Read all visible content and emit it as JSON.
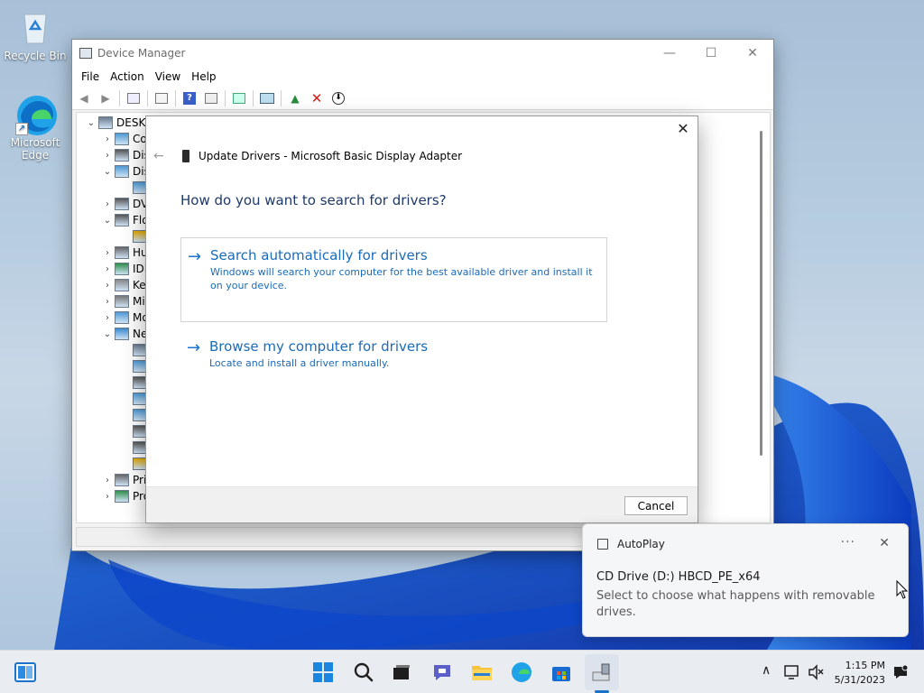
{
  "desktop": {
    "icons": [
      {
        "label": "Recycle Bin"
      },
      {
        "label": "Microsoft Edge"
      }
    ]
  },
  "device_manager": {
    "title": "Device Manager",
    "window_controls": {
      "minimize": "—",
      "maximize": "☐",
      "close": "✕"
    },
    "menu": [
      "File",
      "Action",
      "View",
      "Help"
    ],
    "tree": [
      {
        "chev": "⌄",
        "label": "DESKTO"
      },
      {
        "chev": "›",
        "label": "Co"
      },
      {
        "chev": "›",
        "label": "Dis"
      },
      {
        "chev": "⌄",
        "label": "Dis"
      },
      {
        "chev": "",
        "label": ""
      },
      {
        "chev": "›",
        "label": "DV"
      },
      {
        "chev": "⌄",
        "label": "Flo"
      },
      {
        "chev": "",
        "label": ""
      },
      {
        "chev": "›",
        "label": "Hu"
      },
      {
        "chev": "›",
        "label": "IDE"
      },
      {
        "chev": "›",
        "label": "Key"
      },
      {
        "chev": "›",
        "label": "Mi"
      },
      {
        "chev": "›",
        "label": "Mo"
      },
      {
        "chev": "⌄",
        "label": "Ne"
      },
      {
        "chev": "",
        "label": ""
      },
      {
        "chev": "",
        "label": ""
      },
      {
        "chev": "",
        "label": ""
      },
      {
        "chev": "",
        "label": ""
      },
      {
        "chev": "",
        "label": ""
      },
      {
        "chev": "",
        "label": ""
      },
      {
        "chev": "",
        "label": ""
      },
      {
        "chev": "",
        "label": ""
      },
      {
        "chev": "›",
        "label": "Pri"
      },
      {
        "chev": "›",
        "label": "Pro"
      }
    ]
  },
  "update_dialog": {
    "close": "✕",
    "back": "←",
    "title": "Update Drivers - Microsoft Basic Display Adapter",
    "question": "How do you want to search for drivers?",
    "options": [
      {
        "title": "Search automatically for drivers",
        "desc": "Windows will search your computer for the best available driver and install it on your device."
      },
      {
        "title": "Browse my computer for drivers",
        "desc": "Locate and install a driver manually."
      }
    ],
    "cancel_label": "Cancel"
  },
  "toast": {
    "app": "AutoPlay",
    "more": "···",
    "close": "✕",
    "title": "CD Drive (D:) HBCD_PE_x64",
    "body": "Select to choose what happens with removable drives."
  },
  "taskbar": {
    "time": "1:15 PM",
    "date": "5/31/2023",
    "chevron": "∧"
  },
  "colors": {
    "link_blue": "#1a6bb8",
    "heading_navy": "#1f3a66",
    "taskbar_bg": "#e9ecf1"
  }
}
